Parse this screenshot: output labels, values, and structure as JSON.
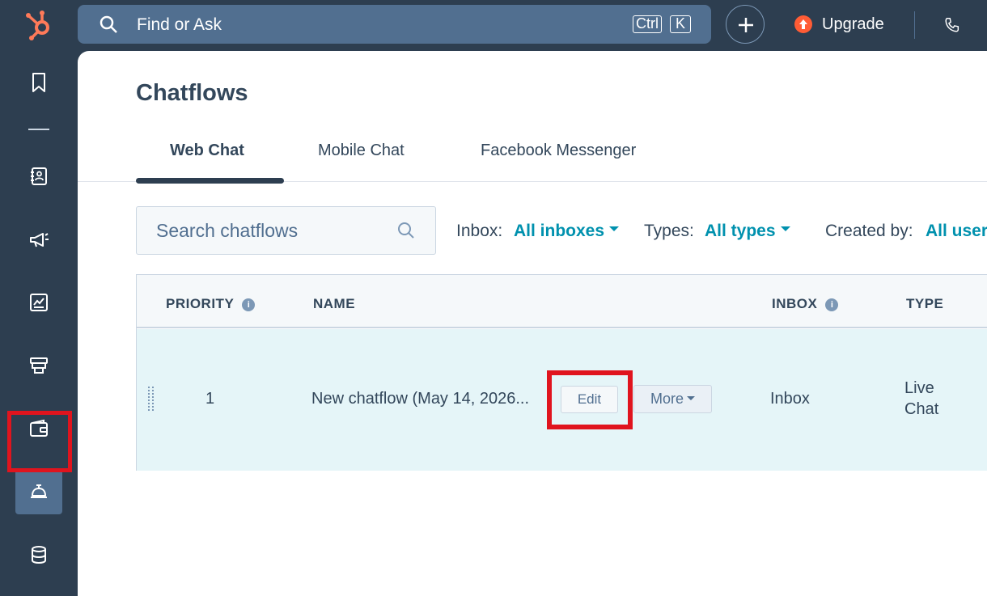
{
  "topbar": {
    "search_text": "Find or Ask",
    "shortcut_ctrl": "Ctrl",
    "shortcut_key": "K",
    "upgrade_label": "Upgrade"
  },
  "sidebar": {
    "items": [
      {
        "icon": "bookmark-icon"
      },
      {
        "icon": "contacts-book-icon"
      },
      {
        "icon": "megaphone-icon"
      },
      {
        "icon": "reports-chart-icon"
      },
      {
        "icon": "commerce-store-icon"
      },
      {
        "icon": "wallet-icon"
      },
      {
        "icon": "service-bell-icon",
        "active": true
      },
      {
        "icon": "database-icon"
      }
    ]
  },
  "page": {
    "title": "Chatflows",
    "tabs": [
      {
        "label": "Web Chat",
        "active": true
      },
      {
        "label": "Mobile Chat"
      },
      {
        "label": "Facebook Messenger"
      }
    ],
    "search_placeholder": "Search chatflows",
    "filters": {
      "inbox_label": "Inbox:",
      "inbox_value": "All inboxes",
      "types_label": "Types:",
      "types_value": "All types",
      "created_label": "Created by:",
      "created_value": "All users"
    }
  },
  "table": {
    "columns": [
      "PRIORITY",
      "NAME",
      "INBOX",
      "TYPE"
    ],
    "rows": [
      {
        "priority": "1",
        "name": "New chatflow (May 14, 2026...",
        "edit_label": "Edit",
        "more_label": "More",
        "inbox": "Inbox",
        "type_line1": "Live",
        "type_line2": "Chat"
      }
    ]
  },
  "colors": {
    "nav_bg": "#2d3e50",
    "accent_link": "#0091ae",
    "row_highlight": "#e5f5f8",
    "annotation_red": "#e0141e"
  }
}
